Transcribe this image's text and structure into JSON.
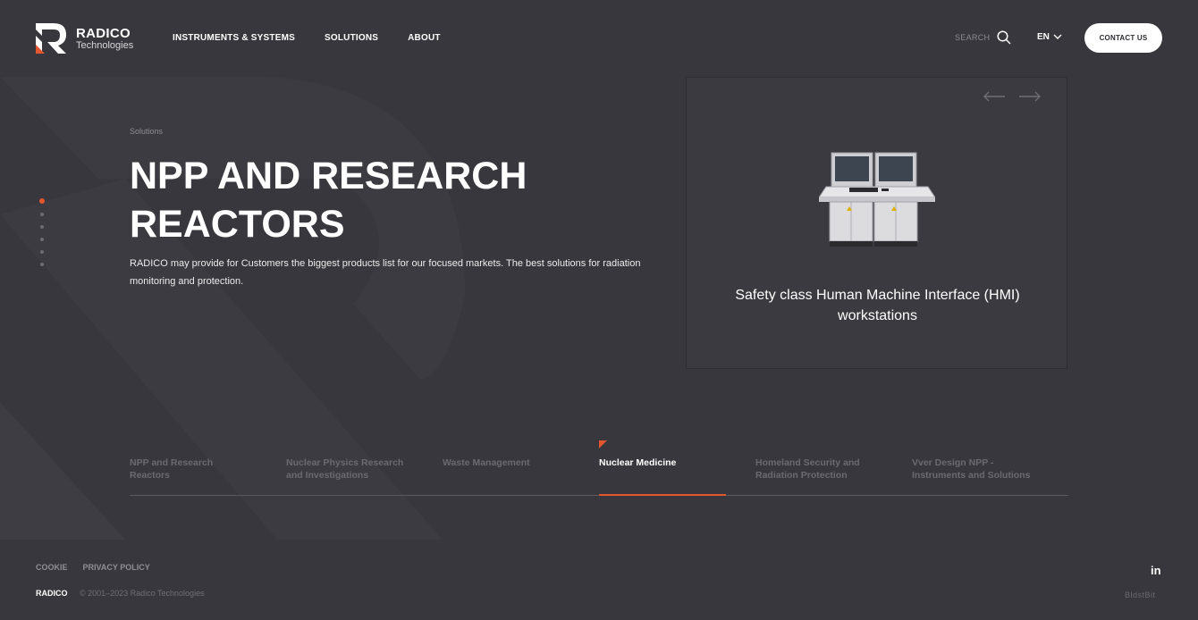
{
  "header": {
    "logo_name": "RADICO",
    "logo_sub": "Technologies",
    "nav": [
      "INSTRUMENTS & SYSTEMS",
      "SOLUTIONS",
      "ABOUT"
    ],
    "search_label": "SEARCH",
    "lang": "EN",
    "contact_label": "CONTACT US"
  },
  "hero": {
    "breadcrumb": "Solutions",
    "title_line1": "NPP AND RESEARCH",
    "title_line2": "REACTORS",
    "description": "RADICO may provide for Customers the biggest products list for our focused markets. The best solutions for radiation monitoring and protection.",
    "slide_count": 6,
    "active_slide": 1
  },
  "card": {
    "title": "Safety class Human Machine Interface (HMI) workstations",
    "image_icon": "hmi-workstation-illustration"
  },
  "tabs": [
    {
      "label": "NPP and Research Reactors",
      "active": false
    },
    {
      "label": "Nuclear Physics Research and Investigations",
      "active": false
    },
    {
      "label": "Waste Management",
      "active": false
    },
    {
      "label": "Nuclear Medicine",
      "active": true
    },
    {
      "label": "Homeland Security and Radiation Protection",
      "active": false
    },
    {
      "label": "Vver Design NPP - Instruments and Solutions",
      "active": false
    }
  ],
  "footer": {
    "links": [
      "COOKIE",
      "PRIVACY POLICY"
    ],
    "brand": "RADICO",
    "copyright": "© 2001–2023 Radico Technologies",
    "social": "in",
    "developer": "BldstBit"
  },
  "colors": {
    "background": "#37373d",
    "accent": "#e4572e",
    "muted_text": "#8e8e94"
  }
}
